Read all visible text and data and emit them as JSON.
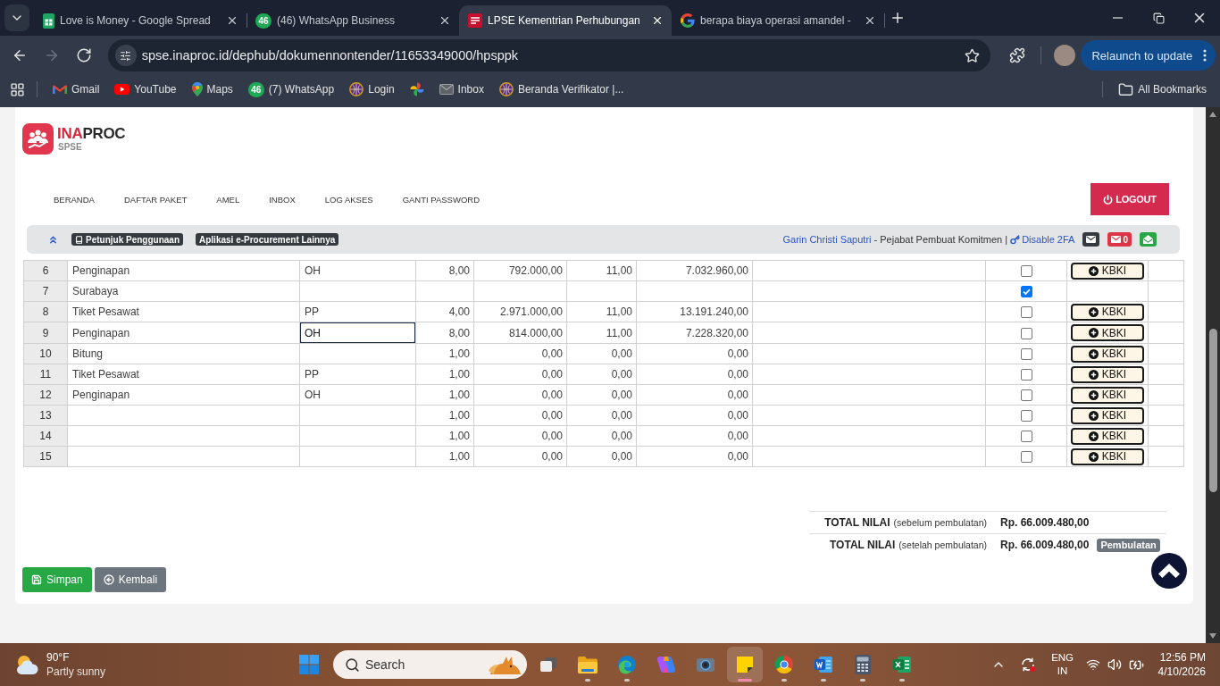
{
  "browser": {
    "tabs": [
      {
        "kind": "sheets",
        "title": "Love is Money - Google Spread",
        "selected": false
      },
      {
        "kind": "whatsapp",
        "badge": "46",
        "title": "(46) WhatsApp Business",
        "selected": false
      },
      {
        "kind": "lpse",
        "title": "LPSE Kementrian Perhubungan",
        "selected": true
      },
      {
        "kind": "google",
        "title": "berapa biaya operasi amandel -",
        "selected": false
      }
    ],
    "nav_buttons": [
      {
        "kind": "back",
        "disabled": false
      },
      {
        "kind": "forward",
        "disabled": true
      },
      {
        "kind": "reload",
        "disabled": false
      }
    ],
    "address": "spse.inaproc.id/dephub/dokumennontender/11653349000/hpsppk",
    "relaunch": "Relaunch to update",
    "bookmarks": [
      {
        "kind": "gmail",
        "label": "Gmail"
      },
      {
        "kind": "youtube",
        "label": "YouTube"
      },
      {
        "kind": "maps",
        "label": "Maps"
      },
      {
        "kind": "whatsapp",
        "badge": "46",
        "label": "(7) WhatsApp"
      },
      {
        "kind": "globe",
        "label": "Login"
      },
      {
        "kind": "photos"
      },
      {
        "kind": "inbox",
        "label": "Inbox"
      },
      {
        "kind": "globe",
        "label": "Beranda Verifikator |..."
      }
    ],
    "all_bookmarks": "All Bookmarks"
  },
  "header": {
    "logo": {
      "accent": "INA",
      "rest": "PROC",
      "sub": "SPSE"
    },
    "nav": [
      "BERANDA",
      "DAFTAR PAKET",
      "AMEL",
      "INBOX",
      "LOG AKSES",
      "GANTI PASSWORD"
    ],
    "logout": "LOGOUT"
  },
  "info_bar": {
    "badges": [
      {
        "kind": "guide",
        "label": "Petunjuk Penggunaan"
      },
      {
        "kind": "plain",
        "label": "Aplikasi e-Procurement Lainnya"
      }
    ],
    "user": "Garin Christi Saputri",
    "role": "- Pejabat Pembuat Komitmen |",
    "two_factor": "Disable 2FA",
    "mail_badges": [
      {
        "kind": "mail",
        "color": "#343a40"
      },
      {
        "kind": "unread",
        "color": "#dc3545",
        "count": "0"
      },
      {
        "kind": "opened",
        "color": "#28a745"
      }
    ]
  },
  "table": {
    "rows": [
      {
        "column_1": "6",
        "column_2": "Penginapan",
        "column_3": "OH",
        "column_4": "8,00",
        "column_5": "792.000,00",
        "column_6": "11,00",
        "column_7": "7.032.960,00",
        "editing": false,
        "checked": false,
        "button": "KBKI"
      },
      {
        "column_1": "7",
        "column_2": "Surabaya",
        "editing": false,
        "checked": true
      },
      {
        "column_1": "8",
        "column_2": "Tiket Pesawat",
        "column_3": "PP",
        "column_4": "4,00",
        "column_5": "2.971.000,00",
        "column_6": "11,00",
        "column_7": "13.191.240,00",
        "editing": false,
        "checked": false,
        "button": "KBKI"
      },
      {
        "column_1": "9",
        "column_2": "Penginapan",
        "column_3": "OH",
        "column_4": "8,00",
        "column_5": "814.000,00",
        "column_6": "11,00",
        "column_7": "7.228.320,00",
        "editing": true,
        "checked": false,
        "button": "KBKI"
      },
      {
        "column_1": "10",
        "column_2": "Bitung",
        "column_4": "1,00",
        "column_5": "0,00",
        "column_6": "0,00",
        "column_7": "0,00",
        "editing": false,
        "checked": false,
        "button": "KBKI"
      },
      {
        "column_1": "11",
        "column_2": "Tiket Pesawat",
        "column_3": "PP",
        "column_4": "1,00",
        "column_5": "0,00",
        "column_6": "0,00",
        "column_7": "0,00",
        "editing": false,
        "checked": false,
        "button": "KBKI"
      },
      {
        "column_1": "12",
        "column_2": "Penginapan",
        "column_3": "OH",
        "column_4": "1,00",
        "column_5": "0,00",
        "column_6": "0,00",
        "column_7": "0,00",
        "editing": false,
        "checked": false,
        "button": "KBKI"
      },
      {
        "column_1": "13",
        "column_4": "1,00",
        "column_5": "0,00",
        "column_6": "0,00",
        "column_7": "0,00",
        "editing": false,
        "checked": false,
        "button": "KBKI"
      },
      {
        "column_1": "14",
        "column_4": "1,00",
        "column_5": "0,00",
        "column_6": "0,00",
        "column_7": "0,00",
        "editing": false,
        "checked": false,
        "button": "KBKI"
      },
      {
        "column_1": "15",
        "column_4": "1,00",
        "column_5": "0,00",
        "column_6": "0,00",
        "column_7": "0,00",
        "editing": false,
        "checked": false,
        "button": "KBKI"
      }
    ]
  },
  "totals": [
    {
      "label": "TOTAL NILAI",
      "note": "(sebelum pembulatan)",
      "value": "Rp. 66.009.480,00"
    },
    {
      "label": "TOTAL NILAI",
      "note": "(setelah pembulatan)",
      "value": "Rp. 66.009.480,00",
      "button": "Pembulatan"
    }
  ],
  "actions": [
    {
      "kind": "save",
      "label": "Simpan",
      "color": "#28a745"
    },
    {
      "kind": "back",
      "label": "Kembali",
      "color": "#6c757d"
    }
  ],
  "taskbar": {
    "weather": {
      "temp": "90°F",
      "desc": "Partly sunny"
    },
    "search_label": "Search",
    "apps": [
      {
        "kind": "taskview",
        "running": false,
        "selected": false
      },
      {
        "kind": "explorer",
        "running": true,
        "selected": false
      },
      {
        "kind": "edge",
        "running": true,
        "selected": false
      },
      {
        "kind": "copilot",
        "running": false,
        "selected": false
      },
      {
        "kind": "camera",
        "running": false,
        "selected": false
      },
      {
        "kind": "notes",
        "running": true,
        "selected": true
      },
      {
        "kind": "chrome",
        "running": true,
        "selected": false
      },
      {
        "kind": "word",
        "running": true,
        "selected": false
      },
      {
        "kind": "calculator",
        "running": true,
        "selected": false
      },
      {
        "kind": "excel",
        "running": true,
        "selected": false
      }
    ],
    "language": [
      "ENG",
      "IN"
    ],
    "time": "12:56 PM",
    "date": "4/10/2026"
  }
}
